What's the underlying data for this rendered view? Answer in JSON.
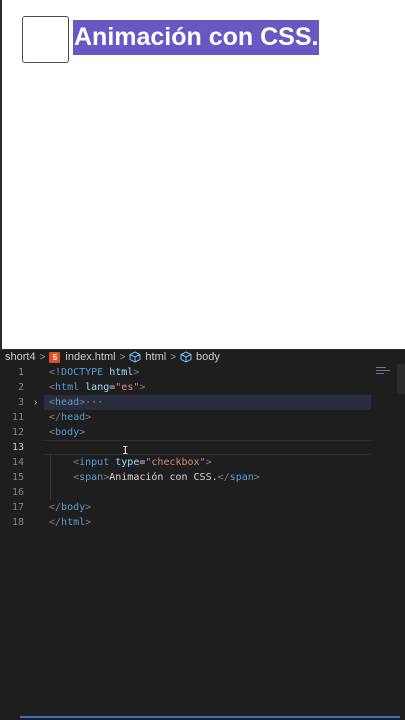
{
  "preview": {
    "label": "Animación con CSS."
  },
  "breadcrumb": {
    "folder": "short4",
    "file": "index.html",
    "element1": "html",
    "element2": "body"
  },
  "editor": {
    "lines": [
      {
        "no": "1",
        "parts": [
          [
            "punc",
            "<"
          ],
          [
            "tag",
            "!DOCTYPE"
          ],
          [
            "txt",
            " "
          ],
          [
            "attr",
            "html"
          ],
          [
            "punc",
            ">"
          ]
        ]
      },
      {
        "no": "2",
        "parts": [
          [
            "punc",
            "<"
          ],
          [
            "tag",
            "html"
          ],
          [
            "txt",
            " "
          ],
          [
            "attr",
            "lang"
          ],
          [
            "txt",
            "="
          ],
          [
            "str",
            "\"es\""
          ],
          [
            "punc",
            ">"
          ]
        ]
      },
      {
        "no": "3",
        "parts": [
          [
            "punc",
            "<"
          ],
          [
            "tag",
            "head"
          ],
          [
            "punc",
            ">"
          ],
          [
            "ellipsis",
            "···"
          ]
        ]
      },
      {
        "no": "11",
        "parts": [
          [
            "punc",
            "</"
          ],
          [
            "tag",
            "head"
          ],
          [
            "punc",
            ">"
          ]
        ]
      },
      {
        "no": "12",
        "parts": [
          [
            "punc",
            "<"
          ],
          [
            "tag",
            "body"
          ],
          [
            "punc",
            ">"
          ]
        ]
      },
      {
        "no": "13",
        "parts": []
      },
      {
        "no": "14",
        "parts": [
          [
            "txt",
            "    "
          ],
          [
            "punc",
            "<"
          ],
          [
            "tag",
            "input"
          ],
          [
            "txt",
            " "
          ],
          [
            "attr",
            "type"
          ],
          [
            "txt",
            "="
          ],
          [
            "str",
            "\"checkbox\""
          ],
          [
            "punc",
            ">"
          ]
        ]
      },
      {
        "no": "15",
        "parts": [
          [
            "txt",
            "    "
          ],
          [
            "punc",
            "<"
          ],
          [
            "tag",
            "span"
          ],
          [
            "punc",
            ">"
          ],
          [
            "txt",
            "Animación con CSS."
          ],
          [
            "punc",
            "</"
          ],
          [
            "tag",
            "span"
          ],
          [
            "punc",
            ">"
          ]
        ]
      },
      {
        "no": "16",
        "parts": []
      },
      {
        "no": "17",
        "parts": [
          [
            "punc",
            "</"
          ],
          [
            "tag",
            "body"
          ],
          [
            "punc",
            ">"
          ]
        ]
      },
      {
        "no": "18",
        "parts": [
          [
            "punc",
            "</"
          ],
          [
            "tag",
            "html"
          ],
          [
            "punc",
            ">"
          ]
        ]
      }
    ],
    "cursor_glyph": "I",
    "fold_glyph": "›"
  },
  "colors": {
    "tag": "#569cd6",
    "attr": "#9cdcfe",
    "string": "#ce9178",
    "highlight": "#6858c4"
  }
}
